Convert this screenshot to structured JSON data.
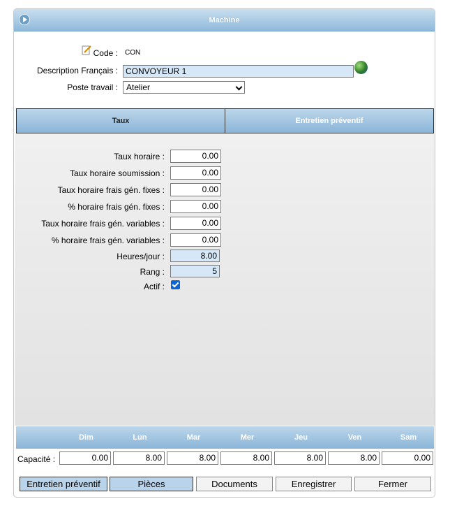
{
  "window": {
    "title": "Machine"
  },
  "header": {
    "code_label": "Code :",
    "code_value": "CON",
    "description_label": "Description Français :",
    "description_value": "CONVOYEUR 1",
    "poste_label": "Poste travail :",
    "poste_value": "Atelier"
  },
  "tabs": [
    {
      "label": "Taux",
      "selected": true
    },
    {
      "label": "Entretien préventif",
      "selected": false
    }
  ],
  "taux": {
    "taux_horaire": {
      "label": "Taux horaire :",
      "value": "0.00"
    },
    "taux_horaire_soumission": {
      "label": "Taux horaire soumission :",
      "value": "0.00"
    },
    "taux_horaire_fg_fixes": {
      "label": "Taux horaire frais gén. fixes :",
      "value": "0.00"
    },
    "pct_horaire_fg_fixes": {
      "label": "% horaire frais gén. fixes :",
      "value": "0.00"
    },
    "taux_horaire_fg_variables": {
      "label": "Taux horaire frais gén. variables :",
      "value": "0.00"
    },
    "pct_horaire_fg_variables": {
      "label": "% horaire frais gén. variables :",
      "value": "0.00"
    },
    "heures_jour": {
      "label": "Heures/jour :",
      "value": "8.00"
    },
    "rang": {
      "label": "Rang :",
      "value": "5"
    },
    "actif": {
      "label": "Actif :",
      "checked": true
    }
  },
  "capacity": {
    "label": "Capacité :",
    "days": [
      "Dim",
      "Lun",
      "Mar",
      "Mer",
      "Jeu",
      "Ven",
      "Sam"
    ],
    "values": [
      "0.00",
      "8.00",
      "8.00",
      "8.00",
      "8.00",
      "8.00",
      "0.00"
    ]
  },
  "buttons": {
    "entretien": "Entretien préventif",
    "pieces": "Pièces",
    "documents": "Documents",
    "enregistrer": "Enregistrer",
    "fermer": "Fermer"
  },
  "colors": {
    "header_blue": "#8fb9da",
    "input_highlight": "#d6e7f7",
    "checkbox_blue": "#0b63d6"
  }
}
